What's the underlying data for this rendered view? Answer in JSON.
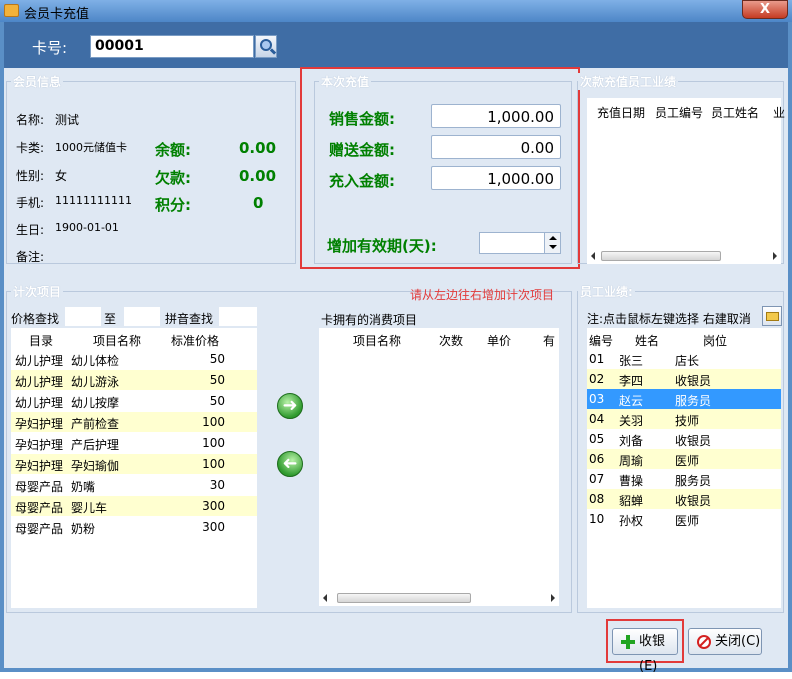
{
  "window": {
    "title": "会员卡充值",
    "close_label": "X"
  },
  "card": {
    "label": "卡号:",
    "value": "00001"
  },
  "member": {
    "group_title": "会员信息",
    "name_label": "名称:",
    "name_value": "测试",
    "type_label": "卡类:",
    "type_value": "1000元储值卡",
    "gender_label": "性别:",
    "gender_value": "女",
    "phone_label": "手机:",
    "phone_value": "11111111111",
    "birthday_label": "生日:",
    "birthday_value": "1900-01-01",
    "remark_label": "备注:",
    "balance_label": "余额:",
    "balance_value": "0.00",
    "debt_label": "欠款:",
    "debt_value": "0.00",
    "points_label": "积分:",
    "points_value": "0"
  },
  "recharge": {
    "group_title": "本次充值",
    "sale_label": "销售金额:",
    "sale_value": "1,000.00",
    "gift_label": "赠送金额:",
    "gift_value": "0.00",
    "charge_label": "充入金额:",
    "charge_value": "1,000.00",
    "validity_label": "增加有效期(天):",
    "validity_value": ""
  },
  "staff_perf": {
    "group_title": "次款充值员工业绩",
    "columns": [
      "充值日期",
      "员工编号",
      "员工姓名",
      "业"
    ]
  },
  "items": {
    "group_title": "计次项目",
    "note": "请从左边往右增加计次项目",
    "price_search_label": "价格查找",
    "to_label": "至",
    "pinyin_label": "拼音查找",
    "columns": [
      "目录",
      "项目名称",
      "标准价格"
    ],
    "rows": [
      {
        "cat": "幼儿护理",
        "name": "幼儿体检",
        "price": "50"
      },
      {
        "cat": "幼儿护理",
        "name": "幼儿游泳",
        "price": "50"
      },
      {
        "cat": "幼儿护理",
        "name": "幼儿按摩",
        "price": "50"
      },
      {
        "cat": "孕妇护理",
        "name": "产前检查",
        "price": "100"
      },
      {
        "cat": "孕妇护理",
        "name": "产后护理",
        "price": "100"
      },
      {
        "cat": "孕妇护理",
        "name": "孕妇瑜伽",
        "price": "100"
      },
      {
        "cat": "母婴产品",
        "name": "奶嘴",
        "price": "30"
      },
      {
        "cat": "母婴产品",
        "name": "婴儿车",
        "price": "300"
      },
      {
        "cat": "母婴产品",
        "name": "奶粉",
        "price": "300"
      }
    ],
    "add_label": "➜",
    "remove_label": "➜"
  },
  "card_items": {
    "title": "卡拥有的消费项目",
    "columns": [
      "项目名称",
      "次数",
      "单价",
      "有"
    ]
  },
  "employees": {
    "group_title": "员工业绩:",
    "hint": "注:点击鼠标左键选择 右建取消",
    "columns": [
      "编号",
      "姓名",
      "岗位"
    ],
    "rows": [
      {
        "id": "01",
        "name": "张三",
        "role": "店长"
      },
      {
        "id": "02",
        "name": "李四",
        "role": "收银员"
      },
      {
        "id": "03",
        "name": "赵云",
        "role": "服务员"
      },
      {
        "id": "04",
        "name": "关羽",
        "role": "技师"
      },
      {
        "id": "05",
        "name": "刘备",
        "role": "收银员"
      },
      {
        "id": "06",
        "name": "周瑜",
        "role": "医师"
      },
      {
        "id": "07",
        "name": "曹操",
        "role": "服务员"
      },
      {
        "id": "08",
        "name": "貂蝉",
        "role": "收银员"
      },
      {
        "id": "10",
        "name": "孙权",
        "role": "医师"
      }
    ]
  },
  "buttons": {
    "checkout": "收银(E)",
    "close": "关闭(C)"
  }
}
